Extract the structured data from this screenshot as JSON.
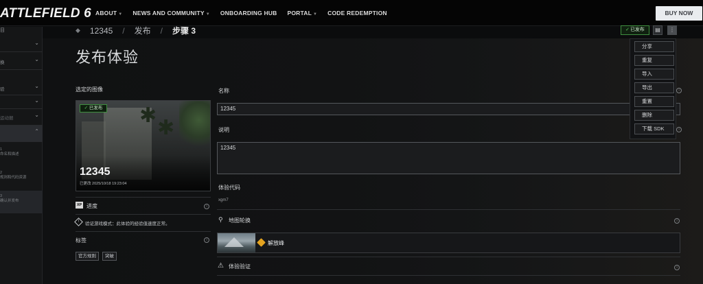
{
  "topnav": {
    "brand": "ATTLEFIELD 6",
    "links": [
      {
        "label": "ABOUT",
        "dropdown": true
      },
      {
        "label": "NEWS AND COMMUNITY",
        "dropdown": true
      },
      {
        "label": "ONBOARDING HUB",
        "dropdown": false
      },
      {
        "label": "PORTAL",
        "dropdown": true
      },
      {
        "label": "CODE REDEMPTION",
        "dropdown": false
      }
    ],
    "buy_label": "BUY NOW"
  },
  "sidebar": {
    "title": "目",
    "items": [
      {
        "label": ""
      },
      {
        "label": "换"
      },
      {
        "label": "验"
      },
      {
        "label": ""
      },
      {
        "label": "运动据"
      }
    ],
    "steps": [
      {
        "num": "1",
        "text": "命名和描述"
      },
      {
        "num": "2",
        "text": "规则和代码资源"
      },
      {
        "num": "3",
        "text": "确认并发布"
      }
    ]
  },
  "breadcrumb": {
    "items": [
      "12345",
      "发布",
      "步骤 3"
    ],
    "separator": "/"
  },
  "toolbar": {
    "published_label": "已发布",
    "check": "✓",
    "save_icon": "▤",
    "more_icon": "⋮"
  },
  "menu": {
    "items": [
      "分享",
      "重复",
      "导入",
      "导出",
      "重置",
      "删除",
      "下载 SDK"
    ]
  },
  "page": {
    "title": "发布体验"
  },
  "left_panel": {
    "selected_image_label": "选定的图像",
    "image_badge": "已发布",
    "image_name": "12345",
    "image_modified": "已更改  2025/10/18 19:23:04",
    "progress_label": "进度",
    "xp_icon_text": "XP",
    "validation_text": "验证游戏模式：此体验的经验值速度正常。",
    "tags_label": "标签",
    "tags": [
      "官方规则",
      "突破"
    ]
  },
  "form": {
    "name_label": "名称",
    "name_value": "12345",
    "desc_label": "说明",
    "desc_value": "12345",
    "code_label": "体验代码",
    "code_value": "xgm7",
    "map_rotation_label": "地图轮换",
    "map_name": "解放峰",
    "verify_label": "体验验证"
  },
  "colors": {
    "accent_green": "#3f8f3f",
    "map_tag": "#e4a320",
    "buy_bg": "#e9ecef"
  }
}
